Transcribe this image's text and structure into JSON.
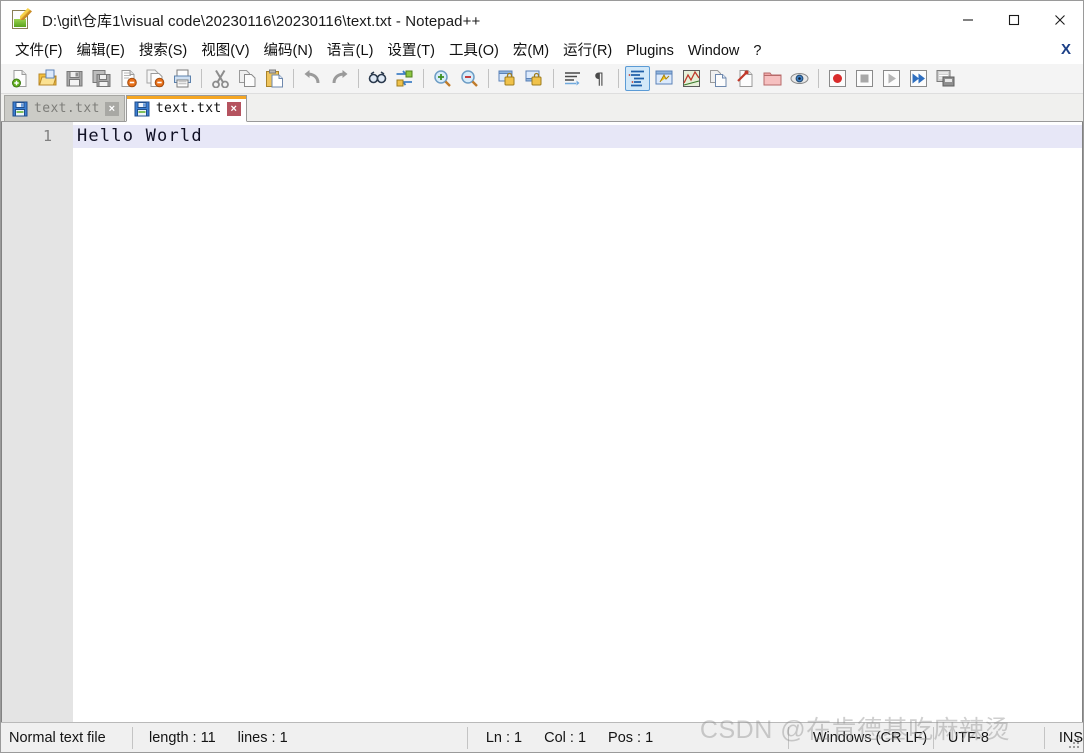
{
  "window": {
    "title": "D:\\git\\仓库1\\visual code\\20230116\\20230116\\text.txt - Notepad++",
    "app_icon": "notepad-plus-plus-icon",
    "controls": {
      "minimize": "minimize-icon",
      "maximize": "maximize-icon",
      "close": "close-icon"
    }
  },
  "menubar": {
    "items": [
      {
        "label": "文件(F)",
        "name": "menu-file"
      },
      {
        "label": "编辑(E)",
        "name": "menu-edit"
      },
      {
        "label": "搜索(S)",
        "name": "menu-search"
      },
      {
        "label": "视图(V)",
        "name": "menu-view"
      },
      {
        "label": "编码(N)",
        "name": "menu-encoding"
      },
      {
        "label": "语言(L)",
        "name": "menu-language"
      },
      {
        "label": "设置(T)",
        "name": "menu-settings"
      },
      {
        "label": "工具(O)",
        "name": "menu-tools"
      },
      {
        "label": "宏(M)",
        "name": "menu-macro"
      },
      {
        "label": "运行(R)",
        "name": "menu-run"
      },
      {
        "label": "Plugins",
        "name": "menu-plugins"
      },
      {
        "label": "Window",
        "name": "menu-window"
      },
      {
        "label": "?",
        "name": "menu-help"
      }
    ],
    "close_doc_label": "X"
  },
  "toolbar": {
    "groups": [
      [
        "new-file-icon",
        "open-file-icon",
        "save-icon",
        "save-all-icon",
        "close-file-icon",
        "close-all-files-icon",
        "print-icon"
      ],
      [
        "cut-icon",
        "copy-icon",
        "paste-icon"
      ],
      [
        "undo-icon",
        "redo-icon"
      ],
      [
        "find-icon",
        "replace-icon"
      ],
      [
        "zoom-in-icon",
        "zoom-out-icon"
      ],
      [
        "sync-vertical-scroll-icon",
        "sync-horizontal-scroll-icon"
      ],
      [
        "word-wrap-icon",
        "show-all-characters-icon"
      ],
      [
        "indent-guideline-icon",
        "user-defined-language-icon",
        "document-map-icon",
        "document-list-icon",
        "function-list-icon",
        "folder-as-workspace-icon",
        "monitoring-icon"
      ],
      [
        "macro-record-icon",
        "macro-stop-icon",
        "macro-play-icon",
        "macro-playback-multiple-icon",
        "macro-save-icon"
      ]
    ],
    "active_button": "indent-guideline-icon"
  },
  "tabs": [
    {
      "label": "text.txt",
      "active": false,
      "icon": "saved-file-icon",
      "close": "×"
    },
    {
      "label": "text.txt",
      "active": true,
      "icon": "saved-file-icon",
      "close": "×"
    }
  ],
  "editor": {
    "line_numbers": [
      "1"
    ],
    "lines": [
      "Hello World"
    ],
    "current_line_index": 0
  },
  "statusbar": {
    "file_type": "Normal text file",
    "length_label": "length : 11",
    "lines_label": "lines : 1",
    "ln": "Ln : 1",
    "col": "Col : 1",
    "pos": "Pos : 1",
    "eol": "Windows (CR LF)",
    "encoding": "UTF-8",
    "insert_mode": "INS"
  },
  "watermark": {
    "text": "CSDN @在肯德基吃麻辣烫"
  },
  "colors": {
    "tab_active_accent": "#f5a623",
    "toolbar_active_bg": "#d2e8f8",
    "current_line_bg": "#e7e7f7",
    "gutter_bg": "#e4e4e4"
  }
}
